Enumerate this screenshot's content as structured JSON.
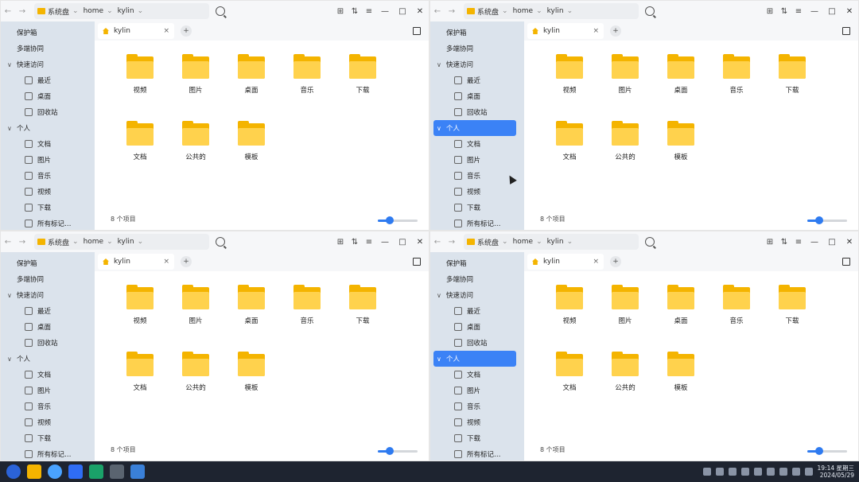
{
  "colors": {
    "folder": "#f4b400",
    "folder_front": "#ffd24d",
    "accent": "#3b82f6",
    "sidebar_bg": "#dbe3ec",
    "taskbar_bg": "#1e2430"
  },
  "windows": [
    {
      "path": [
        {
          "label": "系统盘",
          "icon": "folder-icon"
        },
        {
          "label": "home"
        },
        {
          "label": "kylin"
        }
      ],
      "tab": {
        "label": "kylin",
        "close": "×"
      },
      "tab_add": "+",
      "sidebar": [
        {
          "type": "child",
          "label": "保护箱",
          "icon": "vault-icon"
        },
        {
          "type": "child",
          "label": "多端协同",
          "icon": "link-icon"
        },
        {
          "type": "group",
          "label": "快速访问",
          "caret": "∨"
        },
        {
          "type": "leaf",
          "label": "最近",
          "icon": "clock-icon"
        },
        {
          "type": "leaf",
          "label": "桌面",
          "icon": "desktop-icon"
        },
        {
          "type": "leaf",
          "label": "回收站",
          "icon": "trash-icon"
        },
        {
          "type": "group",
          "label": "个人",
          "caret": "∨"
        },
        {
          "type": "leaf",
          "label": "文档",
          "icon": "document-icon"
        },
        {
          "type": "leaf",
          "label": "图片",
          "icon": "image-icon"
        },
        {
          "type": "leaf",
          "label": "音乐",
          "icon": "music-icon"
        },
        {
          "type": "leaf",
          "label": "视频",
          "icon": "video-icon"
        },
        {
          "type": "leaf",
          "label": "下载",
          "icon": "download-icon"
        },
        {
          "type": "leaf",
          "label": "所有标记…",
          "icon": "tag-icon"
        }
      ],
      "files": [
        "视频",
        "图片",
        "桌面",
        "音乐",
        "下载",
        "文档",
        "公共的",
        "模板"
      ],
      "status": "8 个项目"
    },
    {
      "path": [
        {
          "label": "系统盘",
          "icon": "folder-icon"
        },
        {
          "label": "home"
        },
        {
          "label": "kylin"
        }
      ],
      "tab": {
        "label": "kylin",
        "close": "×"
      },
      "tab_add": "+",
      "sidebar": [
        {
          "type": "child",
          "label": "保护箱",
          "icon": "vault-icon"
        },
        {
          "type": "child",
          "label": "多端协同",
          "icon": "link-icon"
        },
        {
          "type": "group",
          "label": "快速访问",
          "caret": "∨"
        },
        {
          "type": "leaf",
          "label": "最近",
          "icon": "clock-icon"
        },
        {
          "type": "leaf",
          "label": "桌面",
          "icon": "desktop-icon"
        },
        {
          "type": "leaf",
          "label": "回收站",
          "icon": "trash-icon"
        },
        {
          "type": "group",
          "label": "个人",
          "caret": "∨",
          "selected": true
        },
        {
          "type": "leaf",
          "label": "文档",
          "icon": "document-icon"
        },
        {
          "type": "leaf",
          "label": "图片",
          "icon": "image-icon"
        },
        {
          "type": "leaf",
          "label": "音乐",
          "icon": "music-icon"
        },
        {
          "type": "leaf",
          "label": "视频",
          "icon": "video-icon"
        },
        {
          "type": "leaf",
          "label": "下载",
          "icon": "download-icon"
        },
        {
          "type": "leaf",
          "label": "所有标记…",
          "icon": "tag-icon"
        }
      ],
      "files": [
        "视频",
        "图片",
        "桌面",
        "音乐",
        "下载",
        "文档",
        "公共的",
        "模板"
      ],
      "status": "8 个项目"
    },
    {
      "path": [
        {
          "label": "系统盘",
          "icon": "folder-icon"
        },
        {
          "label": "home"
        },
        {
          "label": "kylin"
        }
      ],
      "tab": {
        "label": "kylin",
        "close": "×"
      },
      "tab_add": "+",
      "sidebar": [
        {
          "type": "child",
          "label": "保护箱",
          "icon": "vault-icon"
        },
        {
          "type": "child",
          "label": "多端协同",
          "icon": "link-icon"
        },
        {
          "type": "group",
          "label": "快速访问",
          "caret": "∨"
        },
        {
          "type": "leaf",
          "label": "最近",
          "icon": "clock-icon"
        },
        {
          "type": "leaf",
          "label": "桌面",
          "icon": "desktop-icon"
        },
        {
          "type": "leaf",
          "label": "回收站",
          "icon": "trash-icon"
        },
        {
          "type": "group",
          "label": "个人",
          "caret": "∨"
        },
        {
          "type": "leaf",
          "label": "文档",
          "icon": "document-icon"
        },
        {
          "type": "leaf",
          "label": "图片",
          "icon": "image-icon"
        },
        {
          "type": "leaf",
          "label": "音乐",
          "icon": "music-icon"
        },
        {
          "type": "leaf",
          "label": "视频",
          "icon": "video-icon"
        },
        {
          "type": "leaf",
          "label": "下载",
          "icon": "download-icon"
        },
        {
          "type": "leaf",
          "label": "所有标记…",
          "icon": "tag-icon"
        }
      ],
      "files": [
        "视频",
        "图片",
        "桌面",
        "音乐",
        "下载",
        "文档",
        "公共的",
        "模板"
      ],
      "status": "8 个项目"
    },
    {
      "path": [
        {
          "label": "系统盘",
          "icon": "folder-icon"
        },
        {
          "label": "home"
        },
        {
          "label": "kylin"
        }
      ],
      "tab": {
        "label": "kylin",
        "close": "×"
      },
      "tab_add": "+",
      "sidebar": [
        {
          "type": "child",
          "label": "保护箱",
          "icon": "vault-icon"
        },
        {
          "type": "child",
          "label": "多端协同",
          "icon": "link-icon"
        },
        {
          "type": "group",
          "label": "快速访问",
          "caret": "∨"
        },
        {
          "type": "leaf",
          "label": "最近",
          "icon": "clock-icon"
        },
        {
          "type": "leaf",
          "label": "桌面",
          "icon": "desktop-icon"
        },
        {
          "type": "leaf",
          "label": "回收站",
          "icon": "trash-icon"
        },
        {
          "type": "group",
          "label": "个人",
          "caret": "∨",
          "selected": true
        },
        {
          "type": "leaf",
          "label": "文档",
          "icon": "document-icon"
        },
        {
          "type": "leaf",
          "label": "图片",
          "icon": "image-icon"
        },
        {
          "type": "leaf",
          "label": "音乐",
          "icon": "music-icon"
        },
        {
          "type": "leaf",
          "label": "视频",
          "icon": "video-icon"
        },
        {
          "type": "leaf",
          "label": "下载",
          "icon": "download-icon"
        },
        {
          "type": "leaf",
          "label": "所有标记…",
          "icon": "tag-icon"
        }
      ],
      "files": [
        "视频",
        "图片",
        "桌面",
        "音乐",
        "下载",
        "文档",
        "公共的",
        "模板"
      ],
      "status": "8 个项目"
    }
  ],
  "zoom_level": 0.3,
  "taskbar": {
    "time": "19:14 星期三",
    "date": "2024/05/29",
    "apps": [
      "kylin-start-icon",
      "file-manager-icon",
      "browser-icon",
      "mail-icon",
      "store-icon",
      "settings-icon",
      "monitor-icon"
    ]
  }
}
